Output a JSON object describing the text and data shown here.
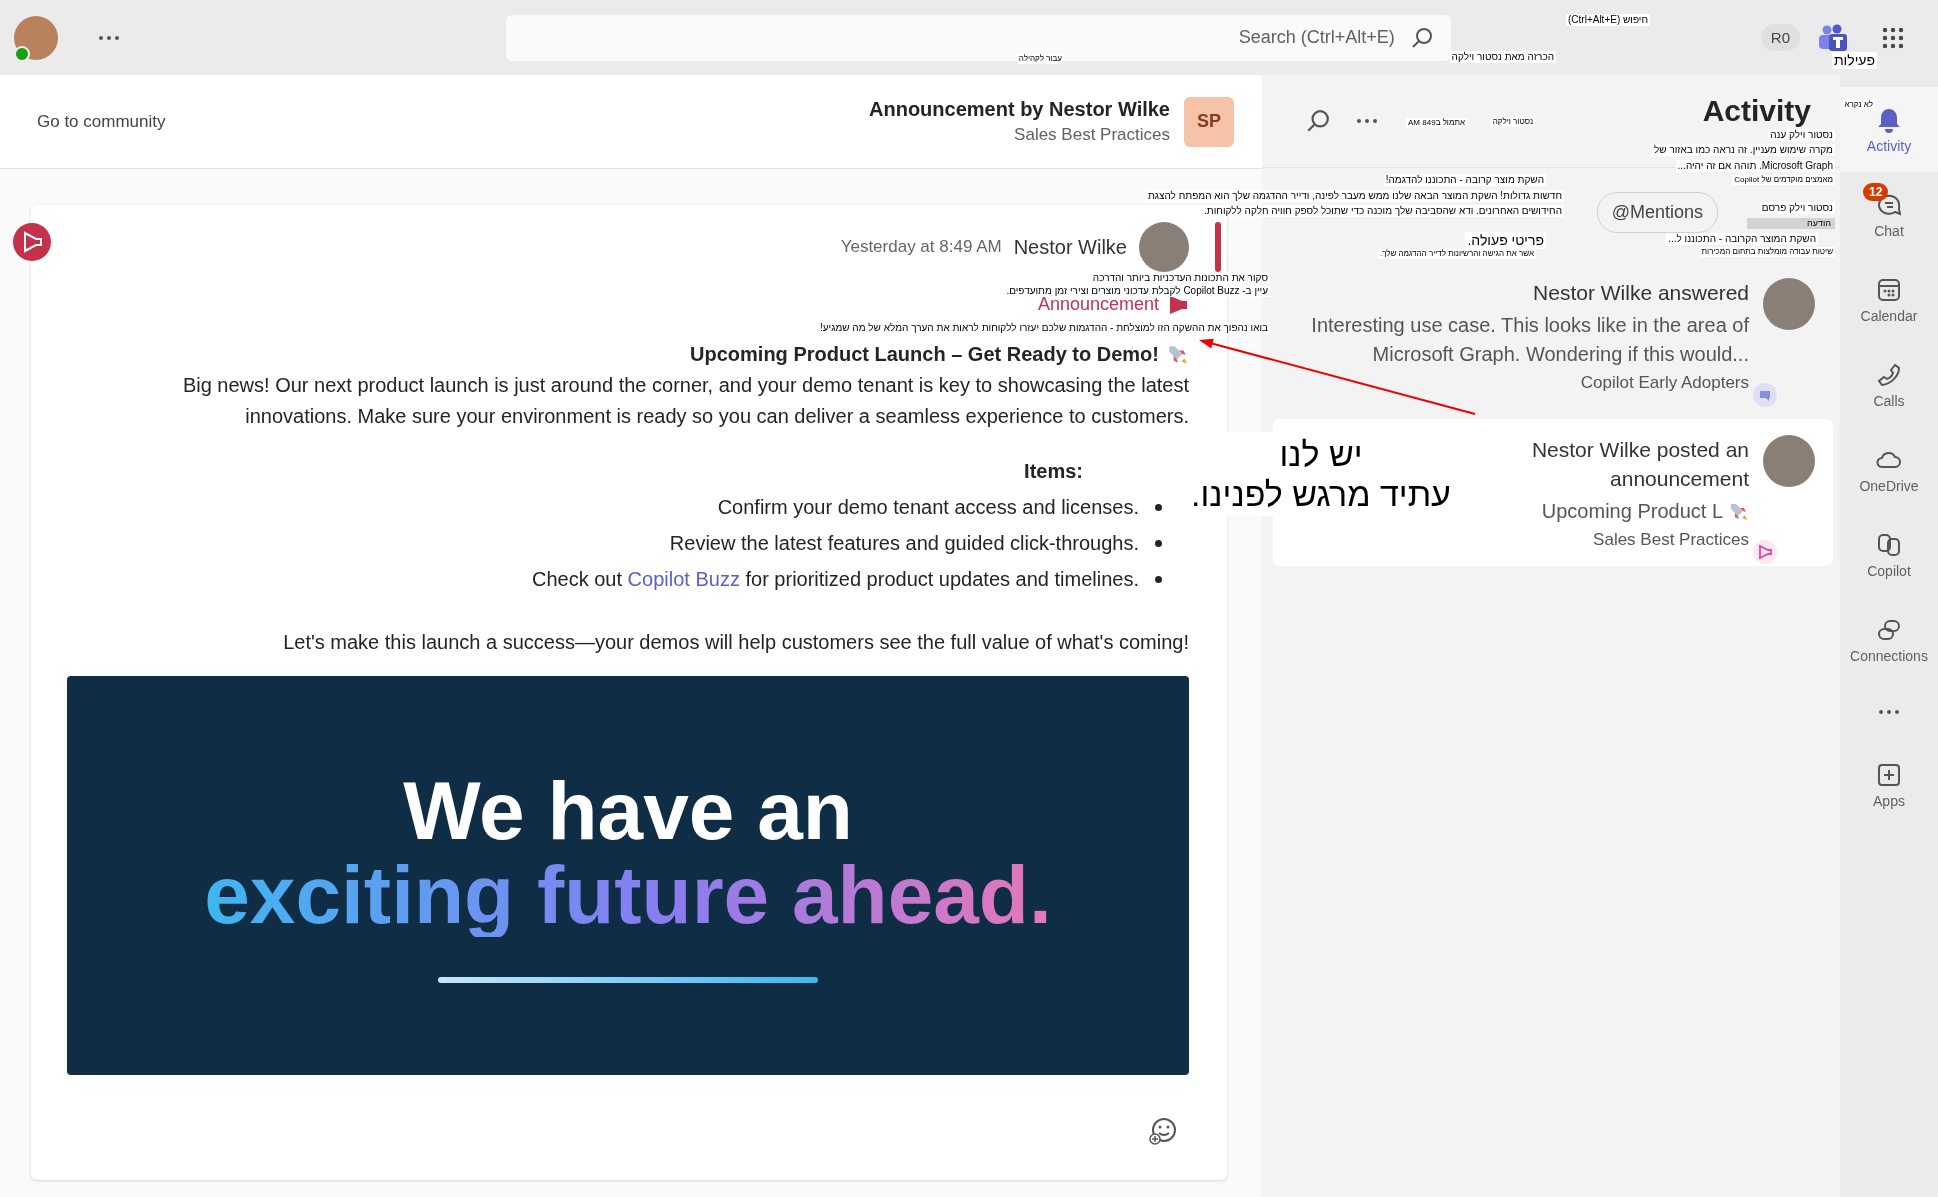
{
  "top_bar": {
    "search": {
      "placeholder": "Search (Ctrl+Alt+E)"
    },
    "user_initials": "R0"
  },
  "sidebar": {
    "items": [
      {
        "kind": "app",
        "label": "Activity",
        "selected": true
      },
      {
        "kind": "app",
        "label": "Chat",
        "selected": false,
        "badge": "12"
      },
      {
        "kind": "app",
        "label": "Calendar",
        "selected": false
      },
      {
        "kind": "app",
        "label": "Calls",
        "selected": false
      },
      {
        "kind": "app",
        "label": "OneDrive",
        "selected": false
      },
      {
        "kind": "app",
        "label": "Copilot",
        "selected": false
      },
      {
        "kind": "app",
        "label": "Connections",
        "selected": false
      },
      {
        "kind": "more"
      },
      {
        "kind": "app",
        "label": "Apps",
        "selected": false
      }
    ]
  },
  "activity": {
    "title": "Activity",
    "filters": [
      {
        "label": "@Mentions",
        "selected": false
      }
    ],
    "items": [
      {
        "kind": "reply",
        "title": "Nestor Wilke answered",
        "preview": "Interesting use case. This looks like in the area of Microsoft Graph. Wondering if this would...",
        "source": "Copilot Early Adopters",
        "selected": false
      },
      {
        "kind": "announcement",
        "title": "Nestor Wilke posted an announcement",
        "preview": "Upcoming Product L",
        "source": "Sales Best Practices",
        "selected": true
      }
    ]
  },
  "post": {
    "header": {
      "badge": "SP",
      "title": "Announcement by Nestor Wilke",
      "community": "Sales Best Practices",
      "link": "Go to community"
    },
    "author": "Nestor Wilke",
    "time": "Yesterday at 8:49 AM",
    "tag": "Announcement",
    "title": "Upcoming Product Launch – Get Ready to Demo!",
    "body": "Big news! Our next product launch is just around the corner, and your demo tenant is key to showcasing the latest innovations. Make sure your environment is ready so you can deliver a seamless experience to customers.",
    "list_heading": "Items:",
    "bullets": [
      {
        "text": "Confirm your demo tenant access and licenses."
      },
      {
        "text": "Review the latest features and guided click-throughs."
      },
      {
        "text": "Check out ",
        "link": "Copilot Buzz",
        "after": " for prioritized product updates and timelines."
      }
    ],
    "closing": "Let's make this launch a success—your demos will help customers see the full value of what's coming!",
    "banner": {
      "lines": [
        "We have an",
        "exciting future ahead."
      ]
    }
  },
  "translation_overlays": [
    {
      "kind": "text",
      "text": "חיפוש (Ctrl+Alt+E)"
    },
    {
      "kind": "heading",
      "text": "פעילות"
    },
    {
      "kind": "text",
      "text": "הכרזה מאת נסטור וילקה"
    },
    {
      "kind": "small",
      "text": "עבור לקהילה"
    },
    {
      "kind": "small",
      "text": "לא נקרא"
    },
    {
      "kind": "small",
      "text": "נסטור וילקה"
    },
    {
      "kind": "small",
      "text": "אתמול ב849 AM"
    },
    {
      "kind": "text",
      "text": "נסטור וילק ענה"
    },
    {
      "kind": "text",
      "text": "מקרה שימוש מעניין. זה נראה כמו באזור של"
    },
    {
      "kind": "text",
      "text": "Microsoft Graph. תוהה אם זה יהיה..."
    },
    {
      "kind": "small",
      "text": "מאמצים מוקדמים של Copilot"
    },
    {
      "kind": "text",
      "text": "השקת מוצר קרובה - התכוננו להדגמה!"
    },
    {
      "kind": "text",
      "text": "חדשות גדולות! השקת המוצר הבאה שלנו ממש מעבר לפינה, ודייר ההדגמה שלך הוא המפתח להצגת"
    },
    {
      "kind": "text",
      "text": "נסטור וילק פרסם"
    },
    {
      "kind": "text",
      "text": "החידושים האחרונים. ודא שהסביבה שלך מוכנה כדי שתוכל לספק חוויה חלקה ללקוחות."
    },
    {
      "kind": "tag",
      "text": "הודעה"
    },
    {
      "kind": "text",
      "text": "השקת המוצר הקרובה - התכוננו ל..."
    },
    {
      "kind": "heading",
      "text": "פריטי פעולה."
    },
    {
      "kind": "small",
      "text": "שיטות עבודה מומלצות בתחום המכירות"
    },
    {
      "kind": "small",
      "text": "אשר את הגישה והרשיונות לדייר ההדגמה שלך."
    },
    {
      "kind": "text",
      "text": "סקור את התכונות העדכניות ביותר והדרכה"
    },
    {
      "kind": "text",
      "text": "עיין ב- Copilot Buzz לקבלת עדכוני מוצרים וצירי זמן מתועדפים."
    },
    {
      "kind": "text",
      "text": "בואו נהפוך את ההשקה הזו למוצלחת - ההדגמות שלכם יעזרו ללקוחות לראות את הערך המלא של מה שמגיע!"
    }
  ],
  "callout": {
    "lines": [
      "יש לנו",
      "עתיד מרגש לפנינו."
    ]
  }
}
